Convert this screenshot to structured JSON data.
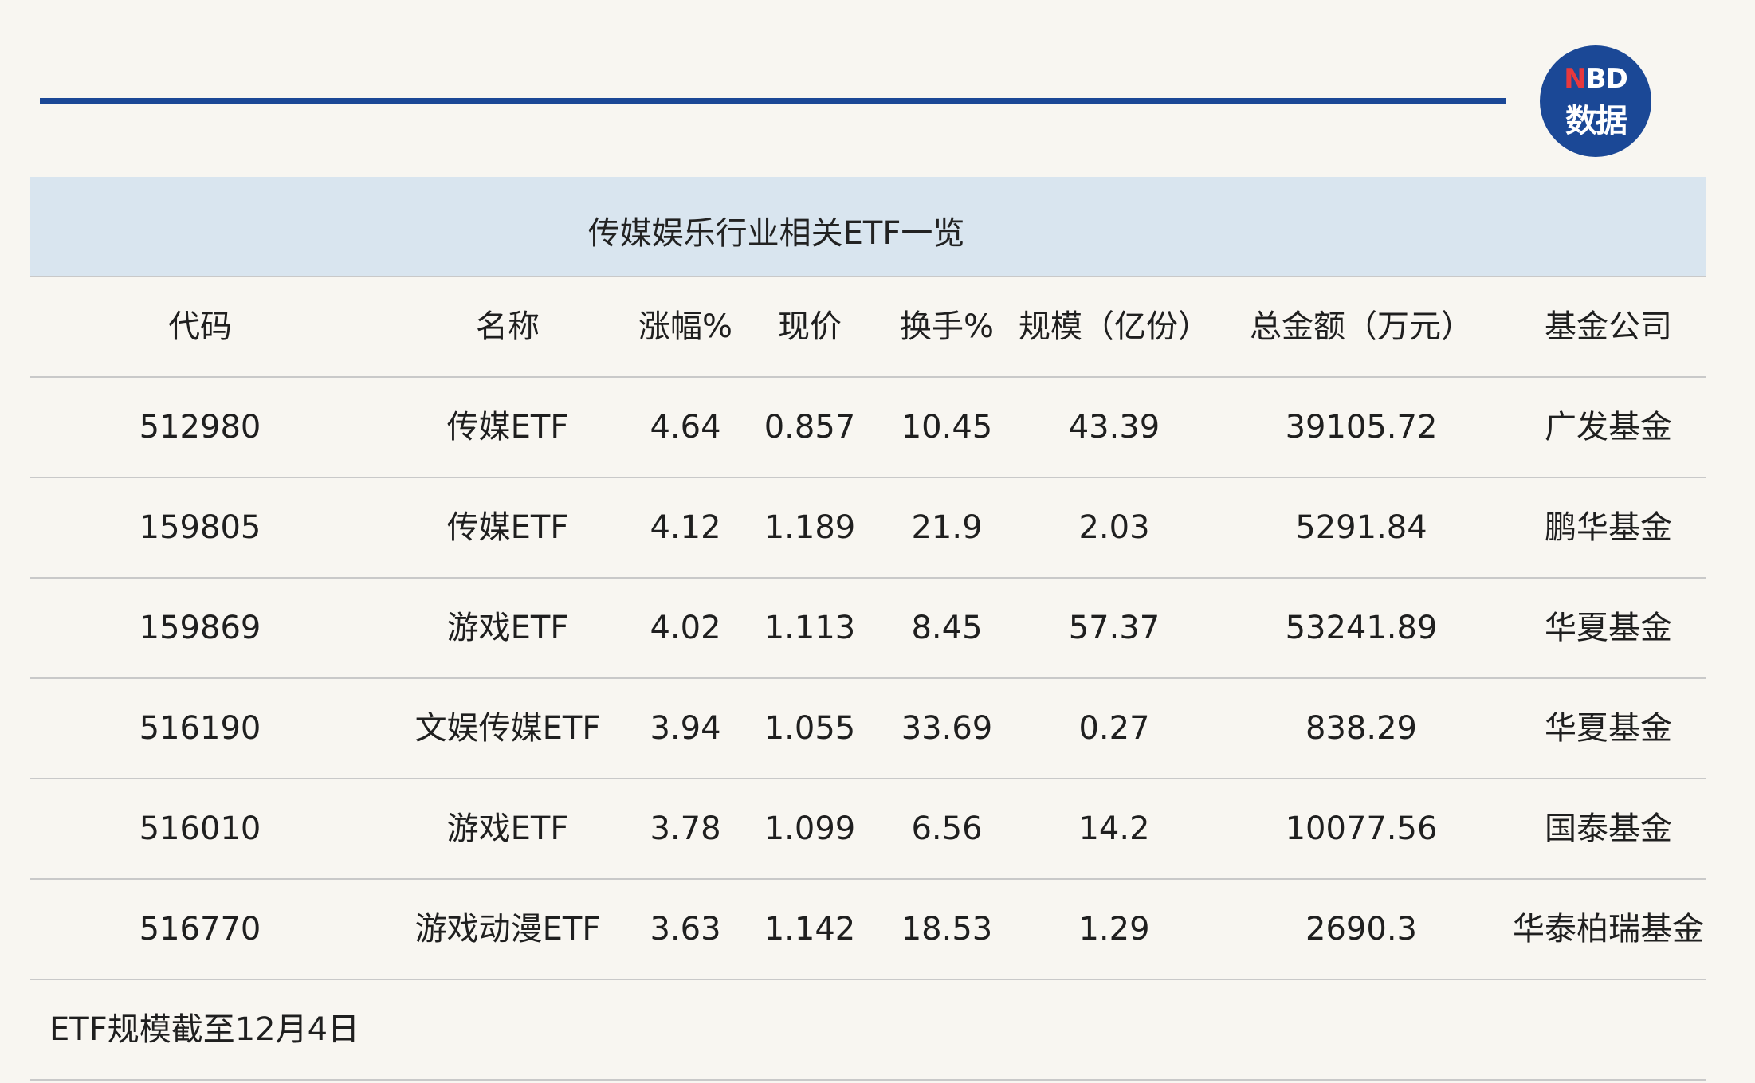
{
  "brand": {
    "logo_line1_n": "N",
    "logo_line1_rest": "BD",
    "logo_line2": "数据"
  },
  "table": {
    "title": "传媒娱乐行业相关ETF一览",
    "headers": [
      "代码",
      "名称",
      "涨幅%",
      "现价",
      "换手%",
      "规模（亿份）",
      "总金额（万元）",
      "基金公司"
    ],
    "rows": [
      [
        "512980",
        "传媒ETF",
        "4.64",
        "0.857",
        "10.45",
        "43.39",
        "39105.72",
        "广发基金"
      ],
      [
        "159805",
        "传媒ETF",
        "4.12",
        "1.189",
        "21.9",
        "2.03",
        "5291.84",
        "鹏华基金"
      ],
      [
        "159869",
        "游戏ETF",
        "4.02",
        "1.113",
        "8.45",
        "57.37",
        "53241.89",
        "华夏基金"
      ],
      [
        "516190",
        "文娱传媒ETF",
        "3.94",
        "1.055",
        "33.69",
        "0.27",
        "838.29",
        "华夏基金"
      ],
      [
        "516010",
        "游戏ETF",
        "3.78",
        "1.099",
        "6.56",
        "14.2",
        "10077.56",
        "国泰基金"
      ],
      [
        "516770",
        "游戏动漫ETF",
        "3.63",
        "1.142",
        "18.53",
        "1.29",
        "2690.3",
        "华泰柏瑞基金"
      ]
    ],
    "footnote": "ETF规模截至12月4日"
  },
  "colors": {
    "accent": "#1b4896",
    "title_band": "#d9e5ef",
    "logo_red": "#e8383d"
  }
}
